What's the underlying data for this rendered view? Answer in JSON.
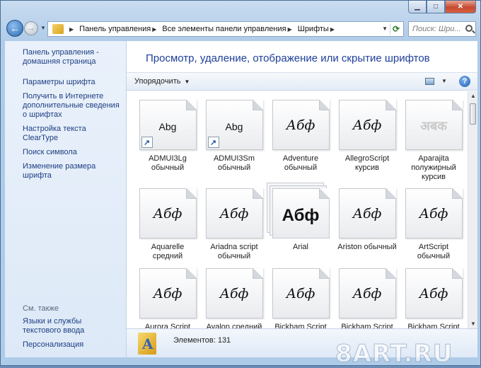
{
  "nav": {
    "breadcrumbs": [
      "Панель управления",
      "Все элементы панели управления",
      "Шрифты"
    ],
    "search_placeholder": "Поиск: Шри..."
  },
  "sidebar": {
    "home": "Панель управления - домашняя страница",
    "links": [
      "Параметры шрифта",
      "Получить в Интернете дополнительные сведения о шрифтах",
      "Настройка текста ClearType",
      "Поиск символа",
      "Изменение размера шрифта"
    ],
    "see_also_label": "См. также",
    "see_also": [
      "Языки и службы текстового ввода",
      "Персонализация"
    ]
  },
  "main": {
    "headline": "Просмотр, удаление, отображение или скрытие шрифтов",
    "organize_label": "Упорядочить"
  },
  "fonts": [
    {
      "name": "ADMUI3Lg обычный",
      "sample": "Abg",
      "style": "sans",
      "shortcut": true
    },
    {
      "name": "ADMUI3Sm обычный",
      "sample": "Abg",
      "style": "sans",
      "shortcut": true
    },
    {
      "name": "Adventure обычный",
      "sample": "Абф",
      "style": "script"
    },
    {
      "name": "AllegroScript курсив",
      "sample": "Абф",
      "style": "script"
    },
    {
      "name": "Aparajita полужирный курсив",
      "sample": "अबक",
      "style": "faint"
    },
    {
      "name": "Aquarelle средний",
      "sample": "Абф",
      "style": "script"
    },
    {
      "name": "Ariadna script обычный",
      "sample": "Абф",
      "style": "script"
    },
    {
      "name": "Arial",
      "sample": "Абф",
      "style": "bold",
      "stack": true
    },
    {
      "name": "Ariston обычный",
      "sample": "Абф",
      "style": "script"
    },
    {
      "name": "ArtScript обычный",
      "sample": "Абф",
      "style": "script"
    },
    {
      "name": "Aurora Script",
      "sample": "Абф",
      "style": "script"
    },
    {
      "name": "Avalon средний",
      "sample": "Абф",
      "style": "script"
    },
    {
      "name": "Bickham Script",
      "sample": "Абф",
      "style": "script"
    },
    {
      "name": "Bickham Script",
      "sample": "Абф",
      "style": "script"
    },
    {
      "name": "Bickham Script",
      "sample": "Абф",
      "style": "script"
    }
  ],
  "details": {
    "count_text": "Элементов: 131"
  },
  "watermark": "8ART.RU"
}
